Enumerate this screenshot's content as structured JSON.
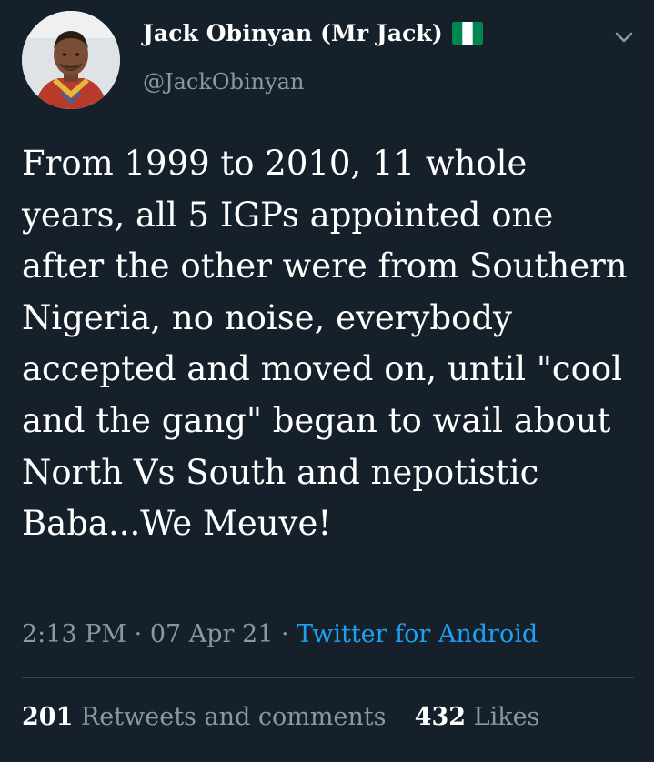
{
  "author": {
    "display_name": "Jack Obinyan (Mr Jack)",
    "handle": "@JackObinyan",
    "flag_icon": "nigeria-flag-icon"
  },
  "tweet": {
    "text": "From 1999 to 2010, 11 whole years, all 5 IGPs appointed one after the other were from Southern Nigeria, no noise, everybody accepted and moved on, until \"cool and the gang\" began to wail about North Vs South and nepotistic Baba...We Meuve!"
  },
  "meta": {
    "time": "2:13 PM",
    "separator": "·",
    "date": "07 Apr 21",
    "source": "Twitter for Android"
  },
  "stats": {
    "retweets_count": "201",
    "retweets_label": "Retweets and comments",
    "likes_count": "432",
    "likes_label": "Likes"
  },
  "colors": {
    "background": "#15202b",
    "text": "#ffffff",
    "secondary": "#8899a6",
    "accent": "#1da1f2",
    "divider": "#38444d"
  }
}
